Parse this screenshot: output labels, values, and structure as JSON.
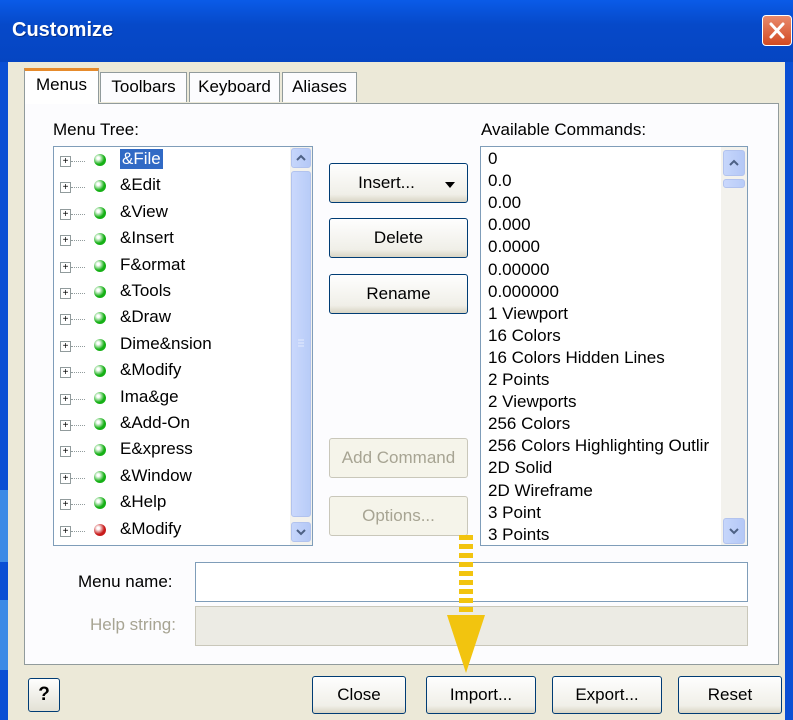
{
  "window": {
    "title": "Customize"
  },
  "tabs": [
    {
      "label": "Menus"
    },
    {
      "label": "Toolbars"
    },
    {
      "label": "Keyboard"
    },
    {
      "label": "Aliases"
    }
  ],
  "menu_tree": {
    "label": "Menu Tree:",
    "items": [
      {
        "label": "&File",
        "selected": true,
        "dot_color": "#16b016"
      },
      {
        "label": "&Edit",
        "dot_color": "#16b016"
      },
      {
        "label": "&View",
        "dot_color": "#16b016"
      },
      {
        "label": "&Insert",
        "dot_color": "#16b016"
      },
      {
        "label": "F&ormat",
        "dot_color": "#16b016"
      },
      {
        "label": "&Tools",
        "dot_color": "#16b016"
      },
      {
        "label": "&Draw",
        "dot_color": "#16b016"
      },
      {
        "label": "Dime&nsion",
        "dot_color": "#16b016"
      },
      {
        "label": "&Modify",
        "dot_color": "#16b016"
      },
      {
        "label": "Ima&ge",
        "dot_color": "#16b016"
      },
      {
        "label": "&Add-On",
        "dot_color": "#16b016"
      },
      {
        "label": "E&xpress",
        "dot_color": "#16b016"
      },
      {
        "label": "&Window",
        "dot_color": "#16b016"
      },
      {
        "label": "&Help",
        "dot_color": "#16b016"
      },
      {
        "label": "&Modify",
        "dot_color": "#c81c1c"
      }
    ]
  },
  "actions": {
    "insert": "Insert...",
    "delete": "Delete",
    "rename": "Rename",
    "add_command": "Add Command",
    "options": "Options..."
  },
  "commands": {
    "label": "Available Commands:",
    "items": [
      "0",
      "0.0",
      "0.00",
      "0.000",
      "0.0000",
      "0.00000",
      "0.000000",
      "1 Viewport",
      "16 Colors",
      "16 Colors Hidden Lines",
      "2 Points",
      "2 Viewports",
      "256 Colors",
      "256 Colors Highlighting Outlir",
      "2D Solid",
      "2D Wireframe",
      "3 Point",
      "3 Points"
    ]
  },
  "fields": {
    "menu_name_label": "Menu name:",
    "menu_name_value": "",
    "help_string_label": "Help string:",
    "help_string_value": ""
  },
  "footer": {
    "help": "?",
    "close": "Close",
    "import": "Import...",
    "export": "Export...",
    "reset": "Reset"
  },
  "colors": {
    "titlebar": "#0649c9",
    "dialog": "#ece9d8",
    "selection": "#316ac5",
    "annotation_arrow": "#f2c40f"
  }
}
